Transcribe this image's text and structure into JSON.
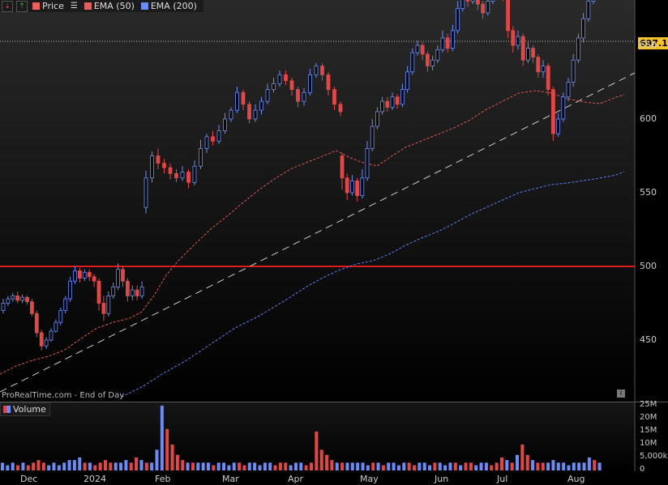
{
  "legend": {
    "price_label": "Price",
    "ema50_label": "EMA (50)",
    "ema200_label": "EMA (200)",
    "price_color": "#f06060",
    "ema50_color": "#e06060",
    "ema200_color": "#6b8cf5"
  },
  "volume_label": "Volume",
  "watermark": "ProRealTime.com - End of Day",
  "info_icon": "i",
  "last_price": "697.12",
  "chart_data": {
    "type": "candlestick",
    "title": "",
    "ylim": [
      420,
      710
    ],
    "y_ticks": [
      450,
      500,
      550,
      600,
      650
    ],
    "y_tick_labels": [
      "450",
      "500",
      "550",
      "600",
      "650"
    ],
    "x_tick_labels": [
      "Dec",
      "2024",
      "Feb",
      "Mar",
      "Apr",
      "May",
      "Jun",
      "Jul",
      "Aug"
    ],
    "horizontal_line": 502,
    "up_color": "#6b8cf5",
    "down_color": "#e04848",
    "candles": [
      {
        "o": 470,
        "c": 475,
        "h": 478,
        "l": 468
      },
      {
        "o": 475,
        "c": 478,
        "h": 480,
        "l": 473
      },
      {
        "o": 478,
        "c": 480,
        "h": 482,
        "l": 476
      },
      {
        "o": 480,
        "c": 477,
        "h": 483,
        "l": 475
      },
      {
        "o": 477,
        "c": 479,
        "h": 481,
        "l": 475
      },
      {
        "o": 479,
        "c": 476,
        "h": 480,
        "l": 474
      },
      {
        "o": 476,
        "c": 468,
        "h": 478,
        "l": 466
      },
      {
        "o": 468,
        "c": 455,
        "h": 470,
        "l": 452
      },
      {
        "o": 455,
        "c": 446,
        "h": 457,
        "l": 443
      },
      {
        "o": 446,
        "c": 450,
        "h": 452,
        "l": 444
      },
      {
        "o": 450,
        "c": 456,
        "h": 458,
        "l": 449
      },
      {
        "o": 456,
        "c": 462,
        "h": 464,
        "l": 455
      },
      {
        "o": 462,
        "c": 470,
        "h": 472,
        "l": 460
      },
      {
        "o": 470,
        "c": 478,
        "h": 480,
        "l": 468
      },
      {
        "o": 478,
        "c": 490,
        "h": 493,
        "l": 476
      },
      {
        "o": 490,
        "c": 497,
        "h": 500,
        "l": 488
      },
      {
        "o": 497,
        "c": 492,
        "h": 499,
        "l": 489
      },
      {
        "o": 492,
        "c": 496,
        "h": 498,
        "l": 490
      },
      {
        "o": 496,
        "c": 493,
        "h": 498,
        "l": 490
      },
      {
        "o": 493,
        "c": 490,
        "h": 495,
        "l": 486
      },
      {
        "o": 490,
        "c": 475,
        "h": 492,
        "l": 470
      },
      {
        "o": 475,
        "c": 468,
        "h": 480,
        "l": 463
      },
      {
        "o": 468,
        "c": 480,
        "h": 483,
        "l": 466
      },
      {
        "o": 480,
        "c": 486,
        "h": 489,
        "l": 478
      },
      {
        "o": 486,
        "c": 498,
        "h": 502,
        "l": 484
      },
      {
        "o": 498,
        "c": 490,
        "h": 500,
        "l": 486
      },
      {
        "o": 490,
        "c": 480,
        "h": 492,
        "l": 476
      },
      {
        "o": 480,
        "c": 484,
        "h": 487,
        "l": 477
      },
      {
        "o": 484,
        "c": 480,
        "h": 487,
        "l": 477
      },
      {
        "o": 480,
        "c": 486,
        "h": 490,
        "l": 478
      },
      {
        "o": 540,
        "c": 560,
        "h": 565,
        "l": 536
      },
      {
        "o": 560,
        "c": 575,
        "h": 578,
        "l": 557
      },
      {
        "o": 575,
        "c": 570,
        "h": 580,
        "l": 566
      },
      {
        "o": 570,
        "c": 567,
        "h": 573,
        "l": 563
      },
      {
        "o": 567,
        "c": 563,
        "h": 570,
        "l": 559
      },
      {
        "o": 563,
        "c": 560,
        "h": 566,
        "l": 557
      },
      {
        "o": 560,
        "c": 564,
        "h": 568,
        "l": 558
      },
      {
        "o": 564,
        "c": 557,
        "h": 566,
        "l": 553
      },
      {
        "o": 557,
        "c": 568,
        "h": 572,
        "l": 555
      },
      {
        "o": 568,
        "c": 580,
        "h": 586,
        "l": 566
      },
      {
        "o": 580,
        "c": 588,
        "h": 590,
        "l": 577
      },
      {
        "o": 588,
        "c": 585,
        "h": 592,
        "l": 582
      },
      {
        "o": 585,
        "c": 592,
        "h": 596,
        "l": 583
      },
      {
        "o": 592,
        "c": 600,
        "h": 604,
        "l": 590
      },
      {
        "o": 600,
        "c": 606,
        "h": 608,
        "l": 598
      },
      {
        "o": 606,
        "c": 618,
        "h": 622,
        "l": 604
      },
      {
        "o": 618,
        "c": 610,
        "h": 620,
        "l": 606
      },
      {
        "o": 610,
        "c": 600,
        "h": 612,
        "l": 597
      },
      {
        "o": 600,
        "c": 606,
        "h": 610,
        "l": 598
      },
      {
        "o": 606,
        "c": 612,
        "h": 615,
        "l": 603
      },
      {
        "o": 612,
        "c": 620,
        "h": 624,
        "l": 610
      },
      {
        "o": 620,
        "c": 624,
        "h": 628,
        "l": 618
      },
      {
        "o": 624,
        "c": 630,
        "h": 633,
        "l": 622
      },
      {
        "o": 630,
        "c": 626,
        "h": 633,
        "l": 623
      },
      {
        "o": 626,
        "c": 620,
        "h": 628,
        "l": 616
      },
      {
        "o": 620,
        "c": 612,
        "h": 622,
        "l": 608
      },
      {
        "o": 612,
        "c": 618,
        "h": 621,
        "l": 609
      },
      {
        "o": 618,
        "c": 630,
        "h": 634,
        "l": 616
      },
      {
        "o": 630,
        "c": 636,
        "h": 638,
        "l": 628
      },
      {
        "o": 636,
        "c": 630,
        "h": 638,
        "l": 626
      },
      {
        "o": 630,
        "c": 620,
        "h": 632,
        "l": 616
      },
      {
        "o": 620,
        "c": 610,
        "h": 622,
        "l": 606
      },
      {
        "o": 610,
        "c": 605,
        "h": 612,
        "l": 602
      },
      {
        "o": 575,
        "c": 560,
        "h": 577,
        "l": 552
      },
      {
        "o": 560,
        "c": 550,
        "h": 563,
        "l": 545
      },
      {
        "o": 550,
        "c": 558,
        "h": 562,
        "l": 548
      },
      {
        "o": 558,
        "c": 548,
        "h": 560,
        "l": 544
      },
      {
        "o": 548,
        "c": 560,
        "h": 566,
        "l": 546
      },
      {
        "o": 560,
        "c": 580,
        "h": 585,
        "l": 558
      },
      {
        "o": 580,
        "c": 595,
        "h": 600,
        "l": 578
      },
      {
        "o": 595,
        "c": 605,
        "h": 608,
        "l": 593
      },
      {
        "o": 605,
        "c": 612,
        "h": 615,
        "l": 603
      },
      {
        "o": 612,
        "c": 608,
        "h": 615,
        "l": 605
      },
      {
        "o": 608,
        "c": 615,
        "h": 618,
        "l": 606
      },
      {
        "o": 615,
        "c": 610,
        "h": 617,
        "l": 607
      },
      {
        "o": 610,
        "c": 620,
        "h": 624,
        "l": 608
      },
      {
        "o": 620,
        "c": 632,
        "h": 636,
        "l": 618
      },
      {
        "o": 632,
        "c": 645,
        "h": 648,
        "l": 630
      },
      {
        "o": 645,
        "c": 650,
        "h": 653,
        "l": 643
      },
      {
        "o": 650,
        "c": 644,
        "h": 652,
        "l": 640
      },
      {
        "o": 644,
        "c": 636,
        "h": 646,
        "l": 632
      },
      {
        "o": 636,
        "c": 640,
        "h": 643,
        "l": 633
      },
      {
        "o": 640,
        "c": 647,
        "h": 650,
        "l": 638
      },
      {
        "o": 647,
        "c": 655,
        "h": 660,
        "l": 645
      },
      {
        "o": 655,
        "c": 648,
        "h": 658,
        "l": 645
      },
      {
        "o": 648,
        "c": 660,
        "h": 664,
        "l": 646
      },
      {
        "o": 660,
        "c": 675,
        "h": 680,
        "l": 658
      },
      {
        "o": 675,
        "c": 685,
        "h": 690,
        "l": 673
      },
      {
        "o": 685,
        "c": 680,
        "h": 688,
        "l": 676
      },
      {
        "o": 680,
        "c": 686,
        "h": 690,
        "l": 678
      },
      {
        "o": 686,
        "c": 678,
        "h": 688,
        "l": 674
      },
      {
        "o": 678,
        "c": 672,
        "h": 680,
        "l": 668
      },
      {
        "o": 672,
        "c": 680,
        "h": 684,
        "l": 670
      },
      {
        "o": 680,
        "c": 688,
        "h": 692,
        "l": 678
      },
      {
        "o": 688,
        "c": 692,
        "h": 695,
        "l": 686
      },
      {
        "o": 692,
        "c": 684,
        "h": 694,
        "l": 680
      },
      {
        "o": 684,
        "c": 660,
        "h": 686,
        "l": 655
      },
      {
        "o": 660,
        "c": 650,
        "h": 663,
        "l": 645
      },
      {
        "o": 650,
        "c": 656,
        "h": 660,
        "l": 647
      },
      {
        "o": 656,
        "c": 640,
        "h": 658,
        "l": 636
      },
      {
        "o": 640,
        "c": 648,
        "h": 652,
        "l": 638
      },
      {
        "o": 648,
        "c": 642,
        "h": 650,
        "l": 638
      },
      {
        "o": 642,
        "c": 632,
        "h": 644,
        "l": 628
      },
      {
        "o": 632,
        "c": 636,
        "h": 640,
        "l": 628
      },
      {
        "o": 636,
        "c": 620,
        "h": 638,
        "l": 616
      },
      {
        "o": 620,
        "c": 590,
        "h": 622,
        "l": 585
      },
      {
        "o": 590,
        "c": 600,
        "h": 604,
        "l": 588
      },
      {
        "o": 600,
        "c": 615,
        "h": 618,
        "l": 598
      },
      {
        "o": 615,
        "c": 625,
        "h": 628,
        "l": 612
      },
      {
        "o": 625,
        "c": 640,
        "h": 644,
        "l": 622
      },
      {
        "o": 640,
        "c": 655,
        "h": 658,
        "l": 638
      },
      {
        "o": 655,
        "c": 668,
        "h": 672,
        "l": 652
      },
      {
        "o": 668,
        "c": 680,
        "h": 684,
        "l": 666
      },
      {
        "o": 680,
        "c": 697,
        "h": 705,
        "l": 678
      }
    ],
    "volume": {
      "y_tick_labels": [
        "25M",
        "20M",
        "15M",
        "10M",
        "5,000k",
        "0"
      ],
      "ylim": [
        0,
        25
      ],
      "values": [
        3,
        2,
        3,
        2,
        3,
        2,
        3,
        4,
        3,
        2,
        3,
        2,
        3,
        4,
        4,
        5,
        3,
        3,
        2,
        3,
        4,
        3,
        3,
        3,
        4,
        3,
        5,
        4,
        3,
        3,
        8,
        25,
        16,
        10,
        6,
        4,
        3,
        3,
        3,
        3,
        3,
        2,
        3,
        3,
        2,
        3,
        3,
        2,
        3,
        3,
        2,
        3,
        3,
        2,
        3,
        3,
        2,
        3,
        3,
        2,
        3,
        15,
        8,
        6,
        4,
        3,
        3,
        3,
        3,
        3,
        3,
        2,
        3,
        3,
        2,
        3,
        3,
        2,
        3,
        3,
        2,
        3,
        3,
        2,
        3,
        3,
        2,
        3,
        3,
        2,
        3,
        3,
        2,
        3,
        3,
        2,
        3,
        5,
        4,
        3,
        6,
        10,
        6,
        4,
        3,
        3,
        3,
        4,
        3,
        3,
        2,
        3,
        3,
        3,
        5,
        4,
        3
      ]
    }
  }
}
